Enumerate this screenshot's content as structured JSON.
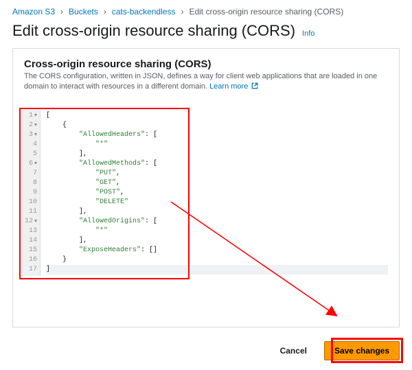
{
  "breadcrumb": {
    "items": [
      {
        "label": "Amazon S3",
        "link": true
      },
      {
        "label": "Buckets",
        "link": true
      },
      {
        "label": "cats-backendless",
        "link": true
      },
      {
        "label": "Edit cross-origin resource sharing (CORS)",
        "link": false
      }
    ]
  },
  "page": {
    "title": "Edit cross-origin resource sharing (CORS)",
    "info_label": "Info"
  },
  "panel": {
    "heading": "Cross-origin resource sharing (CORS)",
    "description": "The CORS configuration, written in JSON, defines a way for client web applications that are loaded in one domain to interact with resources in a different domain.",
    "learn_more_label": "Learn more"
  },
  "editor": {
    "line_numbers": [
      "1",
      "2",
      "3",
      "4",
      "5",
      "6",
      "7",
      "8",
      "9",
      "10",
      "11",
      "12",
      "13",
      "14",
      "15",
      "16",
      "17"
    ],
    "fold_markers_on": [
      1,
      2,
      3,
      6,
      12
    ],
    "highlight_line": 17,
    "cors_json": [
      {
        "AllowedHeaders": [
          "*"
        ],
        "AllowedMethods": [
          "PUT",
          "GET",
          "POST",
          "DELETE"
        ],
        "AllowedOrigins": [
          "*"
        ],
        "ExposeHeaders": []
      }
    ],
    "rendered_lines": [
      "[",
      "    {",
      "        \"AllowedHeaders\": [",
      "            \"*\"",
      "        ],",
      "        \"AllowedMethods\": [",
      "            \"PUT\",",
      "            \"GET\",",
      "            \"POST\",",
      "            \"DELETE\"",
      "        ],",
      "        \"AllowedOrigins\": [",
      "            \"*\"",
      "        ],",
      "        \"ExposeHeaders\": []",
      "    }",
      "]"
    ]
  },
  "footer": {
    "cancel_label": "Cancel",
    "save_label": "Save changes"
  },
  "annotations": {
    "editor_red_box": true,
    "save_red_box": true,
    "arrow": true
  }
}
